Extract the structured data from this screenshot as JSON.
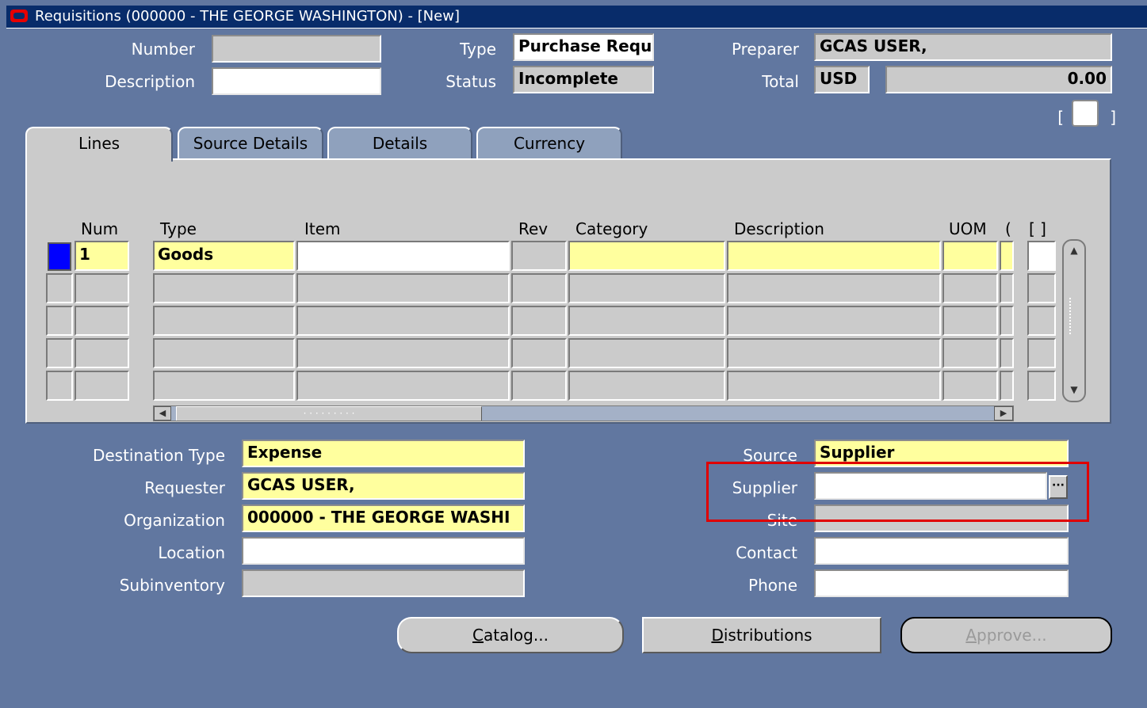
{
  "window": {
    "title": "Requisitions (000000 - THE GEORGE WASHINGTON) - [New]"
  },
  "header": {
    "number_label": "Number",
    "number_value": "",
    "description_label": "Description",
    "description_value": "",
    "type_label": "Type",
    "type_value": "Purchase Requ",
    "status_label": "Status",
    "status_value": "Incomplete",
    "preparer_label": "Preparer",
    "preparer_value": "GCAS USER,",
    "total_label": "Total",
    "currency_value": "USD",
    "total_value": "0.00",
    "dff_open": "[",
    "dff_close": "]"
  },
  "tabs": [
    {
      "label": "Lines",
      "active": true
    },
    {
      "label": "Source Details",
      "active": false
    },
    {
      "label": "Details",
      "active": false
    },
    {
      "label": "Currency",
      "active": false
    }
  ],
  "lines_table": {
    "columns": [
      "Num",
      "Type",
      "Item",
      "Rev",
      "Category",
      "Description",
      "UOM",
      "(",
      "[ ]"
    ],
    "rows": [
      {
        "num": "1",
        "type": "Goods",
        "item": "",
        "rev": "",
        "category": "",
        "description": "",
        "uom": ""
      },
      {
        "num": "",
        "type": "",
        "item": "",
        "rev": "",
        "category": "",
        "description": "",
        "uom": ""
      },
      {
        "num": "",
        "type": "",
        "item": "",
        "rev": "",
        "category": "",
        "description": "",
        "uom": ""
      },
      {
        "num": "",
        "type": "",
        "item": "",
        "rev": "",
        "category": "",
        "description": "",
        "uom": ""
      },
      {
        "num": "",
        "type": "",
        "item": "",
        "rev": "",
        "category": "",
        "description": "",
        "uom": ""
      }
    ],
    "hscroll_dots": "· · · · · · · · ·"
  },
  "line_details": {
    "destination_type_label": "Destination Type",
    "destination_type_value": "Expense",
    "requester_label": "Requester",
    "requester_value": "GCAS USER,",
    "organization_label": "Organization",
    "organization_value": "000000 - THE GEORGE WASHI",
    "location_label": "Location",
    "location_value": "",
    "subinventory_label": "Subinventory",
    "subinventory_value": "",
    "source_label": "Source",
    "source_value": "Supplier",
    "supplier_label": "Supplier",
    "supplier_value": "",
    "site_label": "Site",
    "site_value": "",
    "contact_label": "Contact",
    "contact_value": "",
    "phone_label": "Phone",
    "phone_value": ""
  },
  "buttons": {
    "catalog_mnemonic": "C",
    "catalog_rest": "atalog...",
    "distributions_mnemonic": "D",
    "distributions_rest": "istributions",
    "approve_mnemonic": "A",
    "approve_rest": "pprove..."
  },
  "colors": {
    "background": "#6177a0",
    "titlebar": "#082c6a",
    "required": "#ffff9e",
    "highlight": "#e00000"
  }
}
